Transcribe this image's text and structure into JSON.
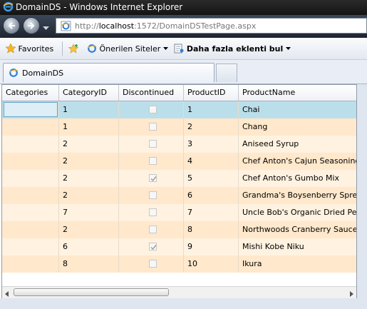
{
  "window": {
    "title": "DomainDS - Windows Internet Explorer"
  },
  "address": {
    "url_prefix": "http://",
    "url_host": "localhost",
    "url_rest": ":1572/DomainDSTestPage.aspx"
  },
  "favorites_bar": {
    "favorites_label": "Favorites",
    "suggested_sites_label": "Önerilen Siteler",
    "addons_label": "Daha fazla eklenti bul"
  },
  "tab": {
    "label": "DomainDS"
  },
  "grid": {
    "columns": [
      "Categories",
      "CategoryID",
      "Discontinued",
      "ProductID",
      "ProductName"
    ],
    "rows": [
      {
        "category_id": "1",
        "discontinued": false,
        "product_id": "1",
        "product_name": "Chai"
      },
      {
        "category_id": "1",
        "discontinued": false,
        "product_id": "2",
        "product_name": "Chang"
      },
      {
        "category_id": "2",
        "discontinued": false,
        "product_id": "3",
        "product_name": "Aniseed Syrup"
      },
      {
        "category_id": "2",
        "discontinued": false,
        "product_id": "4",
        "product_name": "Chef Anton's Cajun Seasoning"
      },
      {
        "category_id": "2",
        "discontinued": true,
        "product_id": "5",
        "product_name": "Chef Anton's Gumbo Mix"
      },
      {
        "category_id": "2",
        "discontinued": false,
        "product_id": "6",
        "product_name": "Grandma's Boysenberry Spread"
      },
      {
        "category_id": "7",
        "discontinued": false,
        "product_id": "7",
        "product_name": "Uncle Bob's Organic Dried Pears"
      },
      {
        "category_id": "2",
        "discontinued": false,
        "product_id": "8",
        "product_name": "Northwoods Cranberry Sauce"
      },
      {
        "category_id": "6",
        "discontinued": true,
        "product_id": "9",
        "product_name": "Mishi Kobe Niku"
      },
      {
        "category_id": "8",
        "discontinued": false,
        "product_id": "10",
        "product_name": "Ikura"
      }
    ]
  },
  "colors": {
    "selected_row": "#bbdfea",
    "row_alt": "#ffe8cc",
    "row_normal": "#fff2e0"
  }
}
